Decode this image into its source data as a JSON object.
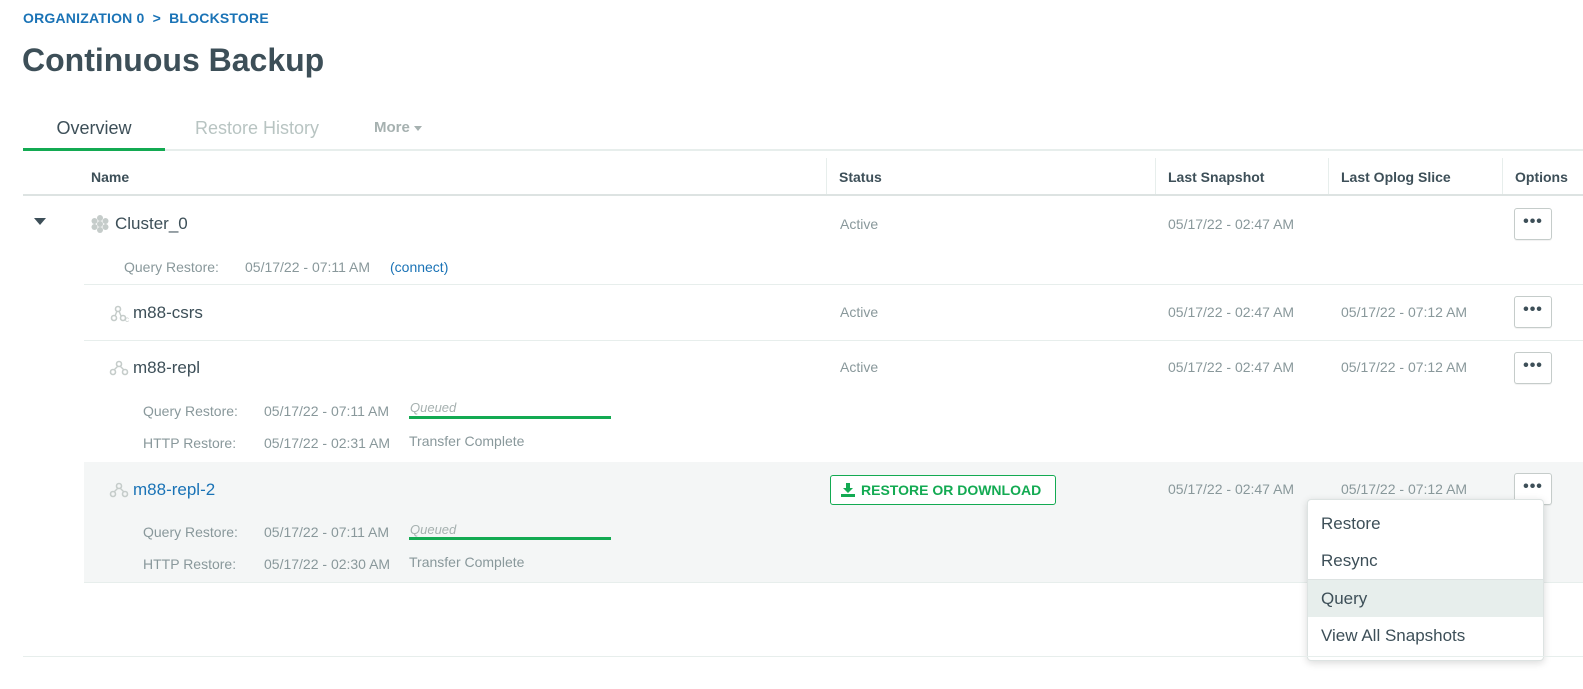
{
  "breadcrumb": {
    "org": "ORGANIZATION 0",
    "sep": ">",
    "project": "BLOCKSTORE"
  },
  "page_title": "Continuous Backup",
  "tabs": {
    "overview": "Overview",
    "restore_history": "Restore History",
    "more": "More"
  },
  "columns": {
    "name": "Name",
    "status": "Status",
    "last_snapshot": "Last Snapshot",
    "last_oplog": "Last Oplog Slice",
    "options": "Options"
  },
  "options_glyph": "•••",
  "rows": {
    "cluster": {
      "name": "Cluster_0",
      "status": "Active",
      "last_snapshot": "05/17/22 - 02:47 AM",
      "query_label": "Query Restore:",
      "query_time": "05/17/22 - 07:11 AM",
      "connect": "(connect)"
    },
    "csrs": {
      "name": "m88-csrs",
      "status": "Active",
      "last_snapshot": "05/17/22 - 02:47 AM",
      "last_oplog": "05/17/22 - 07:12 AM"
    },
    "repl": {
      "name": "m88-repl",
      "status": "Active",
      "last_snapshot": "05/17/22 - 02:47 AM",
      "last_oplog": "05/17/22 - 07:12 AM",
      "query_label": "Query Restore:",
      "query_time": "05/17/22 - 07:11 AM",
      "query_status": "Queued",
      "http_label": "HTTP Restore:",
      "http_time": "05/17/22 - 02:31 AM",
      "http_status": "Transfer Complete"
    },
    "repl2": {
      "name": "m88-repl-2",
      "action": "RESTORE OR DOWNLOAD",
      "last_snapshot": "05/17/22 - 02:47 AM",
      "last_oplog": "05/17/22 - 07:12 AM",
      "query_label": "Query Restore:",
      "query_time": "05/17/22 - 07:11 AM",
      "query_status": "Queued",
      "http_label": "HTTP Restore:",
      "http_time": "05/17/22 - 02:30 AM",
      "http_status": "Transfer Complete"
    }
  },
  "menu": {
    "restore": "Restore",
    "resync": "Resync",
    "query": "Query",
    "view_all": "View All Snapshots"
  },
  "colors": {
    "accent_green": "#13aa52",
    "link_blue": "#1a73b6",
    "text": "#3d4f58",
    "muted": "#89989b"
  }
}
